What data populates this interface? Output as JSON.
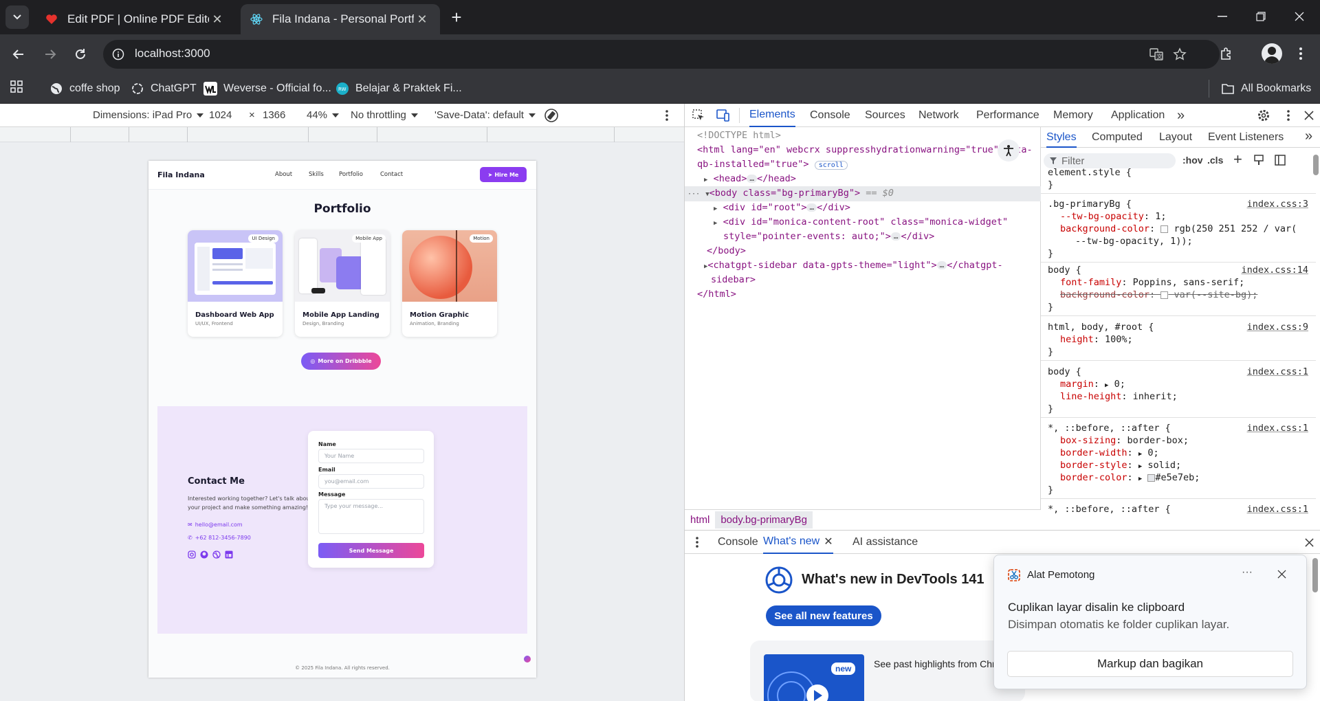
{
  "browser": {
    "tabs": [
      {
        "title": "Edit PDF | Online PDF Editor and",
        "active": false
      },
      {
        "title": "Fila Indana - Personal Portfolio",
        "active": true
      }
    ],
    "url": "localhost:3000",
    "bookmarks": [
      "coffe shop",
      "ChatGPT",
      "Weverse - Official fo...",
      "Belajar & Praktek Fi..."
    ],
    "all_bookmarks": "All Bookmarks"
  },
  "device_toolbar": {
    "dimensions": "Dimensions: iPad Pro",
    "width": "1024",
    "times": "×",
    "height": "1366",
    "zoom": "44%",
    "throttling": "No throttling",
    "save_data": "'Save-Data': default"
  },
  "site": {
    "brand": "Fila Indana",
    "nav": [
      "About",
      "Skills",
      "Portfolio",
      "Contact"
    ],
    "hire": "Hire Me",
    "portfolio_title": "Portfolio",
    "cards": [
      {
        "tag": "UI Design",
        "title": "Dashboard Web App",
        "sub": "UI/UX, Frontend"
      },
      {
        "tag": "Mobile App",
        "title": "Mobile App Landing",
        "sub": "Design, Branding"
      },
      {
        "tag": "Motion",
        "title": "Motion Graphic",
        "sub": "Animation, Branding"
      }
    ],
    "dribbble": "More on Dribbble",
    "contact_title": "Contact Me",
    "contact_text": "Interested working together? Let's talk about your project and make something amazing!",
    "email": "hello@email.com",
    "phone": "+62 812-3456-7890",
    "form": {
      "name_label": "Name",
      "name_placeholder": "Your Name",
      "email_label": "Email",
      "email_placeholder": "you@email.com",
      "message_label": "Message",
      "message_placeholder": "Type your message...",
      "send": "Send Message"
    },
    "footer": "© 2025 Fila Indana. All rights reserved."
  },
  "devtools": {
    "tabs": [
      "Elements",
      "Console",
      "Sources",
      "Network",
      "Performance",
      "Memory",
      "Application"
    ],
    "more": "»",
    "dom": {
      "doctype": "<!DOCTYPE html>",
      "html_open_1": "<html lang=\"en\" webcrx suppresshydrationwarning=\"true\" data-",
      "html_open_2": "qb-installed=\"true\">",
      "scroll_badge": "scroll",
      "head": "<head>",
      "head_close": "</head>",
      "body_open": "<body class=\"bg-primaryBg\">",
      "body_eq": "== $0",
      "root": "<div id=\"root\">",
      "div_close": "</div>",
      "monica_1": "<div id=\"monica-content-root\" class=\"monica-widget\"",
      "monica_2": "style=\"pointer-events: auto;\">",
      "body_close": "</body>",
      "chatgpt_1": "<chatgpt-sidebar data-gpts-theme=\"light\">",
      "chatgpt_close": "</chatgpt-",
      "chatgpt_2": "sidebar>",
      "html_close": "</html>",
      "ellipsis": "…"
    },
    "breadcrumb": [
      "html",
      "body.bg-primaryBg"
    ],
    "styles_tabs": [
      "Styles",
      "Computed",
      "Layout",
      "Event Listeners"
    ],
    "filter_placeholder": "Filter",
    "hov": ":hov",
    "cls": ".cls",
    "rules": {
      "element_style": "element.style {",
      "close": "}",
      "r1_sel": ".bg-primaryBg {",
      "r1_src": "index.css:3",
      "r1_p1": "--tw-bg-opacity",
      "r1_v1": "1;",
      "r1_p2": "background-color",
      "r1_v2": "rgb(250 251 252 / var(",
      "r1_v2b": "--tw-bg-opacity, 1));",
      "r2_sel": "body {",
      "r2_src": "index.css:14",
      "r2_p1": "font-family",
      "r2_v1": "Poppins, sans-serif;",
      "r2_p2": "background-color",
      "r2_v2": "var(--site-bg);",
      "r3_sel": "html, body, #root {",
      "r3_src": "index.css:9",
      "r3_p1": "height",
      "r3_v1": "100%;",
      "r4_sel": "body {",
      "r4_src": "index.css:1",
      "r4_p1": "margin",
      "r4_v1": "0;",
      "r4_p2": "line-height",
      "r4_v2": "inherit;",
      "r5_sel": "*, ::before, ::after {",
      "r5_src": "index.css:1",
      "r5_p1": "box-sizing",
      "r5_v1": "border-box;",
      "r5_p2": "border-width",
      "r5_v2": "0;",
      "r5_p3": "border-style",
      "r5_v3": "solid;",
      "r5_p4": "border-color",
      "r5_v4": "#e5e7eb;",
      "r6_sel": "*, ::before, ::after {",
      "r6_src": "index.css:1"
    },
    "drawer": {
      "tabs": [
        "Console",
        "What's new",
        "AI assistance"
      ],
      "headline": "What's new in DevTools 141",
      "see_all": "See all new features",
      "badge": "new",
      "highlights": "See past highlights from Chr"
    }
  },
  "notification": {
    "app": "Alat Pemotong",
    "more": "···",
    "title": "Cuplikan layar disalin ke clipboard",
    "body": "Disimpan otomatis ke folder cuplikan layar.",
    "action": "Markup dan bagikan"
  },
  "colors": {
    "accent": "#7c3aed",
    "gradient_start": "#7b5cf5",
    "gradient_end": "#ec4899",
    "devtools_blue": "#1a55c9",
    "contact_bg": "#efe6fb"
  }
}
